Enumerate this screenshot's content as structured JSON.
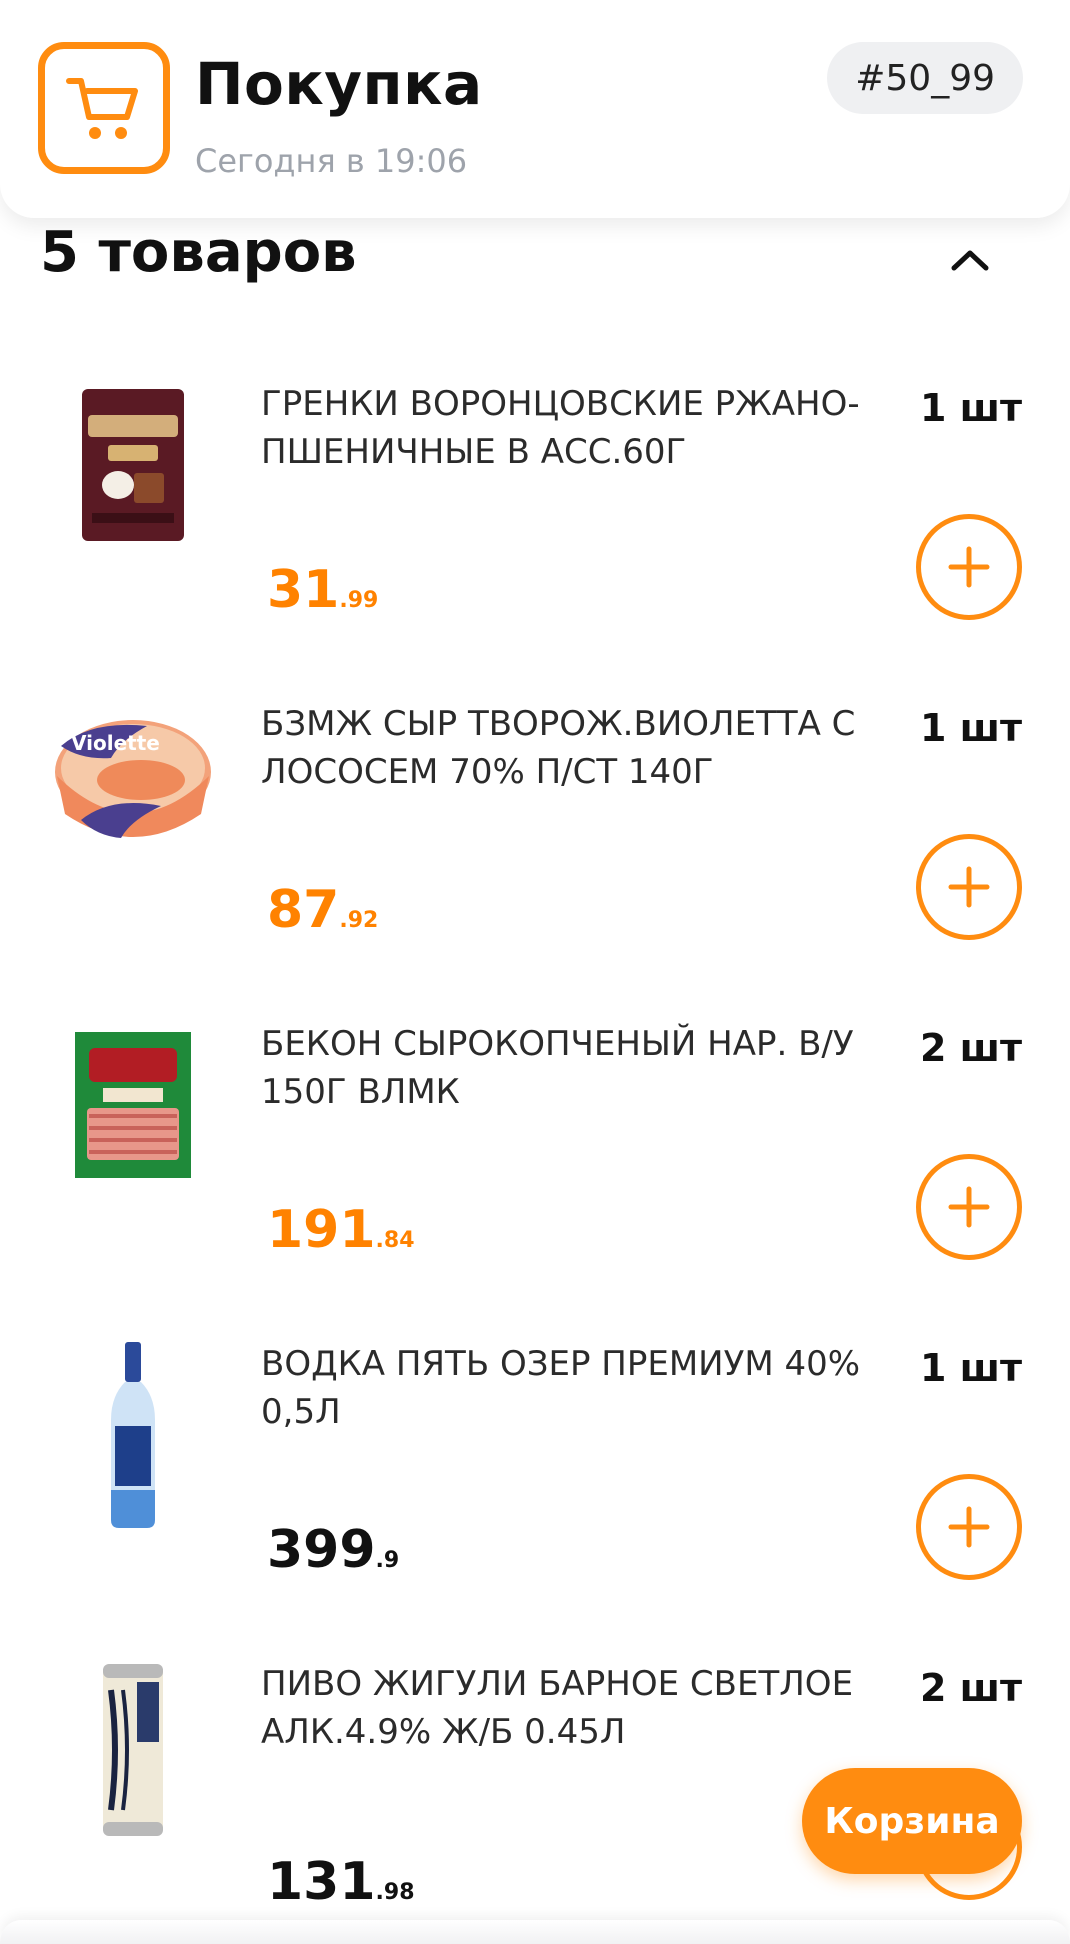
{
  "header": {
    "title": "Покупка",
    "subtitle": "Сегодня в 19:06",
    "order_number": "#50_99",
    "icon": "shopping-cart-icon",
    "accent_color": "#ff8c10"
  },
  "section": {
    "title": "5 товаров",
    "collapse_icon": "chevron-up-icon"
  },
  "items": [
    {
      "name": "ГРЕНКИ ВОРОНЦОВСКИЕ РЖАНО-ПШЕНИЧНЫЕ В АСС.60Г",
      "qty": "1 шт",
      "price_int": "31",
      "price_frac": ".99",
      "price_color": "orange",
      "image": "croutons-pack-image"
    },
    {
      "name": "БЗМЖ СЫР ТВОРОЖ.ВИОЛЕТТА С ЛОСОСЕМ 70% П/СТ 140Г",
      "qty": "1 шт",
      "price_int": "87",
      "price_frac": ".92",
      "price_color": "orange",
      "image": "cream-cheese-tub-image",
      "image_text": "Violette"
    },
    {
      "name": "БЕКОН СЫРОКОПЧЕНЫЙ НАР. В/У 150Г ВЛМК",
      "qty": "2 шт",
      "price_int": "191",
      "price_frac": ".84",
      "price_color": "orange",
      "image": "bacon-pack-image"
    },
    {
      "name": "ВОДКА ПЯТЬ ОЗЕР ПРЕМИУМ 40% 0,5Л",
      "qty": "1 шт",
      "price_int": "399",
      "price_frac": ".9",
      "price_color": "black",
      "image": "vodka-bottle-image"
    },
    {
      "name": "ПИВО ЖИГУЛИ БАРНОЕ СВЕТЛОЕ АЛК.4.9% Ж/Б 0.45Л",
      "qty": "2 шт",
      "price_int": "131",
      "price_frac": ".98",
      "price_color": "black",
      "image": "beer-can-image"
    }
  ],
  "basket_button": {
    "label": "Корзина"
  }
}
